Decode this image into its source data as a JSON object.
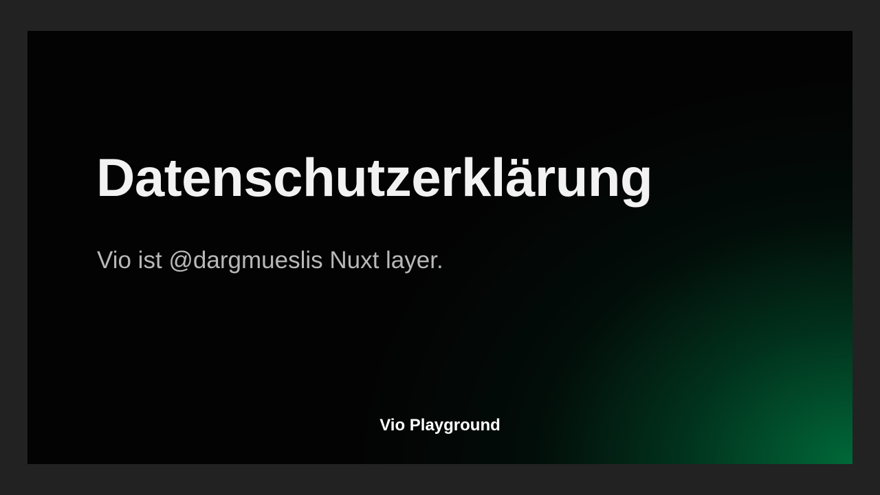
{
  "card": {
    "title": "Datenschutzerklärung",
    "description": "Vio ist @dargmueslis Nuxt layer.",
    "site_name": "Vio Playground"
  },
  "colors": {
    "backdrop": "#222222",
    "card_background": "#030303",
    "accent_green": "#006e3c",
    "title_text": "#f2f2f2",
    "description_text": "#b8b8b8",
    "footer_text": "#ffffff"
  }
}
